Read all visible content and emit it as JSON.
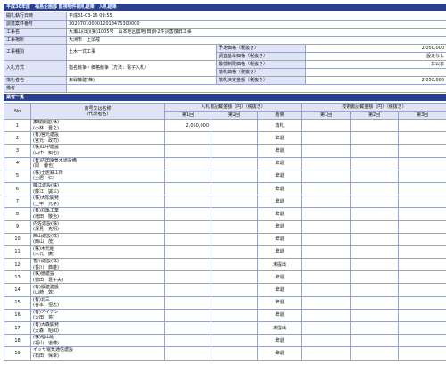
{
  "header": {
    "title": "平成30年度　福島企画部 監視物件開札結果　入札結果"
  },
  "info": {
    "rows": [
      {
        "label": "開札執行日時",
        "value": "平成31-03-15 09:55"
      },
      {
        "label": "調達案件番号",
        "value": "3020701000012018475300000"
      },
      {
        "label": "工事名",
        "value": "大瀬山(出)(第)1005号　山本地区農地(田)外2件災害復旧工事"
      },
      {
        "label": "工事場所",
        "value": "大洲市　上須戒"
      }
    ],
    "kind_label": "工事種別",
    "kind_value": "土木一式工事",
    "method_label": "入札方式",
    "method_value": "指名競争・価格競争（方法：電子入札）",
    "winner_label": "落札者名",
    "winner_value": "東緑藤建(株)",
    "note_label": "備考",
    "note_value": "",
    "right": [
      {
        "label": "予定価格（税抜き）",
        "value": "2,050,000"
      },
      {
        "label": "調査基準価格（税抜き）",
        "value": "設定なし"
      },
      {
        "label": "最低制限価格（税抜き）",
        "value": "非公表"
      },
      {
        "label": "落札価格（税抜き）",
        "value": ""
      },
      {
        "label": "落札決定金額（税抜き）",
        "value": "2,050,000"
      }
    ]
  },
  "bidders": {
    "section_title": "業者一覧",
    "col_no": "No",
    "col_name_1": "商号又は名称",
    "col_name_2": "（代表者名）",
    "group_bid": "入札書記載金額（円）（税抜き）",
    "group_survey": "技術書記載金額（円）（税抜き）",
    "col_r1": "第1回",
    "col_r2": "第2回",
    "col_result": "結果",
    "col_s1": "第1回",
    "col_s2": "第2回",
    "col_s3": "第3回",
    "rows": [
      {
        "no": "1",
        "company": "東緑藤建(株)",
        "rep": "(小林　晋之)",
        "amount": "2,050,000",
        "result": "落札"
      },
      {
        "no": "2",
        "company": "(有)宮元建設",
        "rep": "(宮元　政司)",
        "amount": "",
        "result": "辞退"
      },
      {
        "no": "3",
        "company": "(株)山中建設",
        "rep": "(山中　知也)",
        "amount": "",
        "result": "辞退"
      },
      {
        "no": "4",
        "company": "(有)内田電気水道設備",
        "rep": "(岡　優也)",
        "amount": "",
        "result": "辞退"
      },
      {
        "no": "5",
        "company": "(株)土居鉄工所",
        "rep": "(土居　仁)",
        "amount": "",
        "result": "辞退"
      },
      {
        "no": "6",
        "company": "藤江建設(株)",
        "rep": "(藤江　誠三)",
        "amount": "",
        "result": "辞退"
      },
      {
        "no": "7",
        "company": "(株)大松開発",
        "rep": "(上甲　元子)",
        "amount": "",
        "result": "辞退"
      },
      {
        "no": "8",
        "company": "(有)丸亀工業",
        "rep": "(増田　敬治)",
        "amount": "",
        "result": "辞退"
      },
      {
        "no": "9",
        "company": "内佐建設(株)",
        "rep": "(深見　克明)",
        "amount": "",
        "result": "辞退"
      },
      {
        "no": "10",
        "company": "西山建設(株)",
        "rep": "(西山　茂)",
        "amount": "",
        "result": "辞退"
      },
      {
        "no": "11",
        "company": "(株)木元組",
        "rep": "(木元　廣)",
        "amount": "",
        "result": "辞退"
      },
      {
        "no": "12",
        "company": "香川建設(株)",
        "rep": "(香川　典雄)",
        "amount": "",
        "result": "未提出"
      },
      {
        "no": "13",
        "company": "(株)徳建設",
        "rep": "(徳田　豊子夫)",
        "amount": "",
        "result": "辞退"
      },
      {
        "no": "14",
        "company": "(有)版建建設",
        "rep": "(山崎　敦)",
        "amount": "",
        "result": "辞退"
      },
      {
        "no": "15",
        "company": "(有)北三",
        "rep": "(谷本　恒志)",
        "amount": "",
        "result": "辞退"
      },
      {
        "no": "16",
        "company": "(有)アイテン",
        "rep": "(太田　将)",
        "amount": "",
        "result": "辞退"
      },
      {
        "no": "17",
        "company": "(有)大森開発",
        "rep": "(大森　昭和)",
        "amount": "",
        "result": "未提出"
      },
      {
        "no": "18",
        "company": "(株)福山組",
        "rep": "(福山　道博)",
        "amount": "",
        "result": "辞退"
      },
      {
        "no": "19",
        "company": "イッサ電気通信建設",
        "rep": "(石田　保幸)",
        "amount": "",
        "result": "辞退"
      }
    ]
  }
}
